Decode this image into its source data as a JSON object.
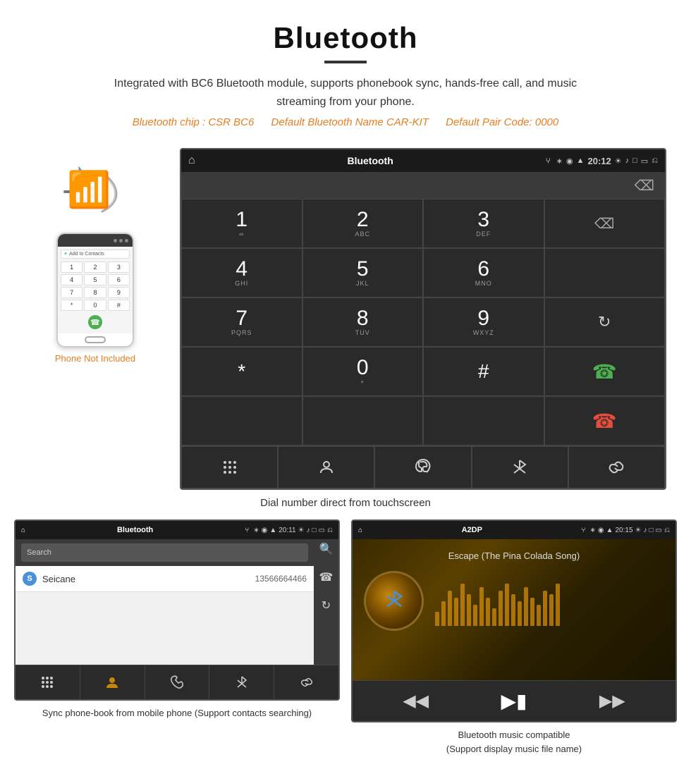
{
  "header": {
    "title": "Bluetooth",
    "description": "Integrated with BC6 Bluetooth module, supports phonebook sync, hands-free call, and music streaming from your phone.",
    "spec_chip": "Bluetooth chip : CSR BC6",
    "spec_name": "Default Bluetooth Name CAR-KIT",
    "spec_code": "Default Pair Code: 0000"
  },
  "dialer": {
    "screen_title": "Bluetooth",
    "time": "20:12",
    "keys": [
      {
        "number": "1",
        "letters": "∞"
      },
      {
        "number": "2",
        "letters": "ABC"
      },
      {
        "number": "3",
        "letters": "DEF"
      },
      {
        "number": "",
        "letters": ""
      },
      {
        "number": "4",
        "letters": "GHI"
      },
      {
        "number": "5",
        "letters": "JKL"
      },
      {
        "number": "6",
        "letters": "MNO"
      },
      {
        "number": "",
        "letters": ""
      },
      {
        "number": "7",
        "letters": "PQRS"
      },
      {
        "number": "8",
        "letters": "TUV"
      },
      {
        "number": "9",
        "letters": "WXYZ"
      },
      {
        "number": "",
        "letters": ""
      },
      {
        "number": "*",
        "letters": ""
      },
      {
        "number": "0",
        "letters": "+"
      },
      {
        "number": "#",
        "letters": ""
      }
    ],
    "actions": [
      "keypad",
      "contacts",
      "phone",
      "bluetooth",
      "link"
    ]
  },
  "caption_dialer": "Dial number direct from touchscreen",
  "phonebook": {
    "screen_title": "Bluetooth",
    "time": "20:11",
    "search_placeholder": "Search",
    "contacts": [
      {
        "letter": "S",
        "name": "Seicane",
        "phone": "13566664466"
      }
    ],
    "caption": "Sync phone-book from mobile phone\n(Support contacts searching)"
  },
  "music": {
    "screen_title": "A2DP",
    "time": "20:15",
    "song_title": "Escape (The Pina Colada Song)",
    "viz_heights": [
      20,
      35,
      50,
      40,
      60,
      45,
      30,
      55,
      40,
      25,
      50,
      60,
      45,
      35,
      55,
      40,
      30,
      50,
      45,
      60
    ],
    "caption": "Bluetooth music compatible\n(Support display music file name)"
  },
  "phone_mockup": {
    "not_included": "Phone Not Included"
  },
  "icons": {
    "home": "⌂",
    "bluetooth": "⬡",
    "usb": "⑂",
    "search_icon": "🔍",
    "prev": "⏮",
    "play_pause": "⏯",
    "next": "⏭",
    "phone_green": "📞",
    "phone_red": "📵"
  }
}
